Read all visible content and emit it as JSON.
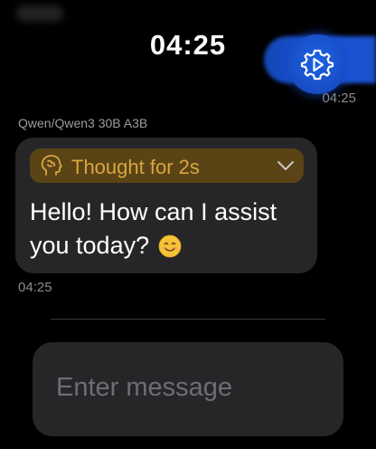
{
  "header": {
    "time": "04:25"
  },
  "user_message": {
    "time": "04:25"
  },
  "assistant": {
    "model": "Qwen/Qwen3 30B A3B",
    "thought_label": "Thought for 2s",
    "message": "Hello! How can I assist you today?",
    "emoji": "smiling-face-icon",
    "time": "04:25"
  },
  "composer": {
    "placeholder": "Enter message"
  },
  "colors": {
    "accent_blue": "#1a5ae0",
    "thought_bg": "#5a4416",
    "thought_text": "#d9a640",
    "bubble_bg": "#262628"
  }
}
